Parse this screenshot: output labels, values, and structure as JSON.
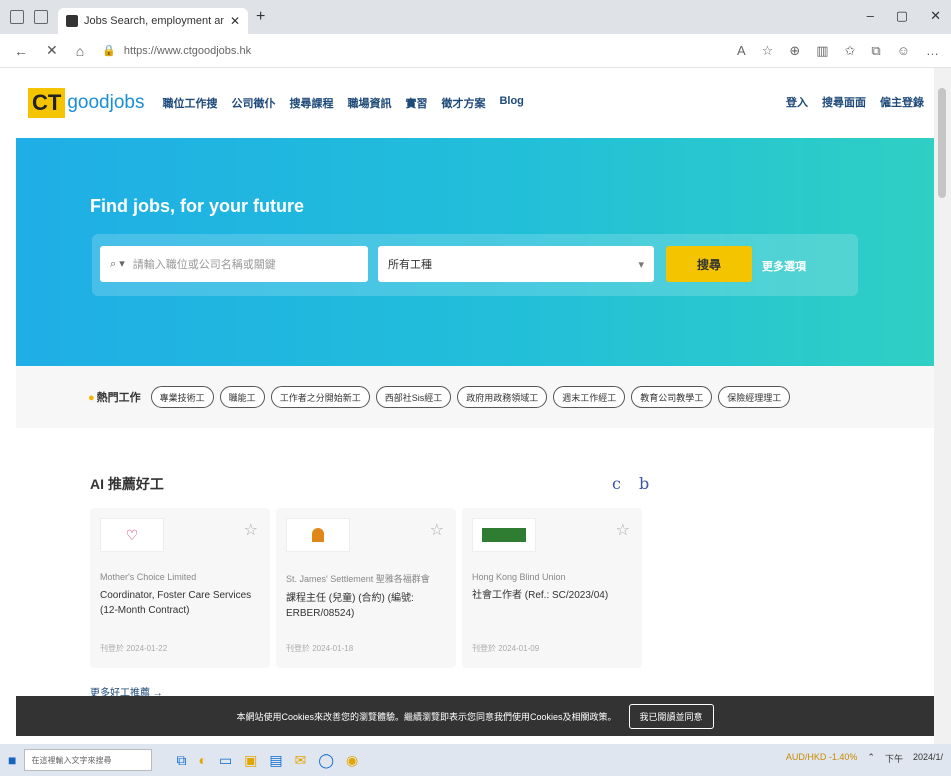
{
  "browser": {
    "tab_title": "Jobs Search, employment and c",
    "url": "https://www.ctgoodjobs.hk",
    "window_controls": [
      "–",
      "▢",
      "✕"
    ]
  },
  "site": {
    "logo_ct": "CT",
    "logo_goodjobs": "goodjobs",
    "nav": [
      "職位工作搜",
      "公司徵仆",
      "搜尋課程",
      "職場資訊",
      "實習",
      "徵才方案",
      "Blog"
    ],
    "header_right": [
      "登入",
      "搜尋面面",
      "僱主登錄"
    ]
  },
  "hero": {
    "title": "Find jobs, for your future",
    "keyword_placeholder": "請輸入職位或公司名稱或關鍵",
    "industry_value": "所有工種",
    "search_button": "搜尋",
    "more_link": "更多選項"
  },
  "hot_jobs": {
    "label": "熱門工作",
    "chips": [
      "專業技術工",
      "職能工",
      "工作者之分開始新工",
      "西部社Sis經工",
      "政府用政務領域工",
      "週末工作經工",
      "教育公司教學工",
      "保險經理理工"
    ]
  },
  "ai": {
    "title": "AI 推薦好工",
    "nav_letters": [
      "c",
      "b"
    ],
    "cards": [
      {
        "company": "Mother's Choice Limited",
        "title": "Coordinator, Foster Care Services (12-Month Contract)",
        "date": "刊登於 2024-01-22"
      },
      {
        "company": "St. James' Settlement 聖雅各福群會",
        "title": "課程主任 (兒童) (合約) (編號: ERBER/08524)",
        "date": "刊登於 2024-01-18"
      },
      {
        "company": "Hong Kong Blind Union",
        "title": "社會工作者 (Ref.: SC/2023/04)",
        "date": "刊登於 2024-01-09"
      }
    ],
    "more_link": "更多好工推薦 →"
  },
  "cookie": {
    "message": "本網站使用Cookies來改善您的瀏覽體驗。繼續瀏覽即表示您同意我們使用Cookies及相關政策。",
    "button": "我已閱讀並同意"
  },
  "taskbar": {
    "search_placeholder": "在這裡輸入文字來搜尋",
    "currency": "AUD/HKD -1.40%",
    "time": "下午",
    "date": "2024/1/"
  },
  "colors": {
    "hero_start": "#1faee6",
    "hero_end": "#2fcfc4",
    "brand_yellow": "#f5c400",
    "nav_blue": "#1e4a7a"
  }
}
